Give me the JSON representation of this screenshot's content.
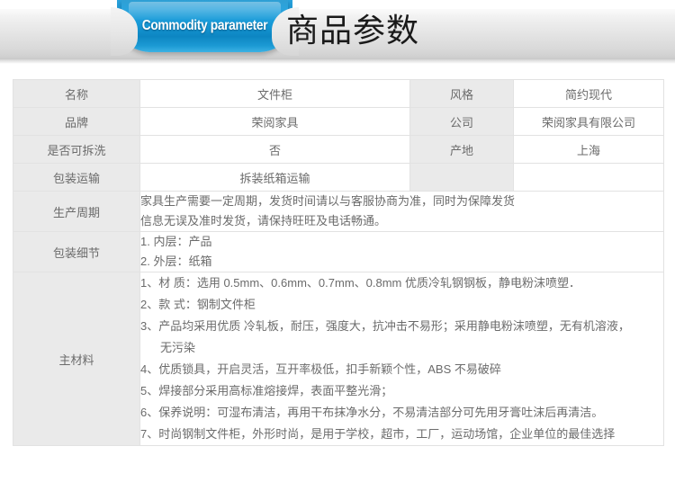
{
  "banner": {
    "ribbon_label": "Commodity parameter",
    "title": "商品参数",
    "ribbon_color": "#1b93cf",
    "band_color": "#e3e3e3"
  },
  "table": {
    "rows": [
      {
        "label_left": "名称",
        "value_left": "文件柜",
        "label_right": "风格",
        "value_right": "简约现代"
      },
      {
        "label_left": "品牌",
        "value_left": "荣阅家具",
        "label_right": "公司",
        "value_right": "荣阅家具有限公司"
      },
      {
        "label_left": "是否可拆洗",
        "value_left": "否",
        "label_right": "产地",
        "value_right": "上海"
      },
      {
        "label_left": "包装运输",
        "value_left": "拆装纸箱运输",
        "label_right": "",
        "value_right": ""
      }
    ],
    "production": {
      "label": "生产周期",
      "lines": [
        "家具生产需要一定周期，发货时间请以与客服协商为准，同时为保障发货",
        "信息无误及准时发货，请保持旺旺及电话畅通。"
      ]
    },
    "packaging": {
      "label": "包装细节",
      "items": [
        "1. 内层：产品",
        "2. 外层：纸箱"
      ]
    },
    "materials": {
      "label": "主材料",
      "items": [
        "1、材 质：选用 0.5mm、0.6mm、0.7mm、0.8mm 优质冷轧钢钢板，静电粉沫喷塑．",
        "2、款 式：钢制文件柜",
        "3、产品均采用优质 冷轧板，耐压，强度大，抗冲击不易形；采用静电粉沫喷塑，无有机溶液，",
        "无污染",
        "4、优质锁具，开启灵活，互开率极低，扣手新颖个性，ABS 不易破碎",
        "5、焊接部分采用高标准熔接焊，表面平整光滑；",
        "6、保养说明：可湿布清洁，再用干布抹净水分，不易清洁部分可先用牙膏吐沫后再清洁。",
        "7、时尚钢制文件柜，外形时尚，是用于学校，超市，工厂，运动场馆，企业单位的最佳选择"
      ]
    }
  }
}
